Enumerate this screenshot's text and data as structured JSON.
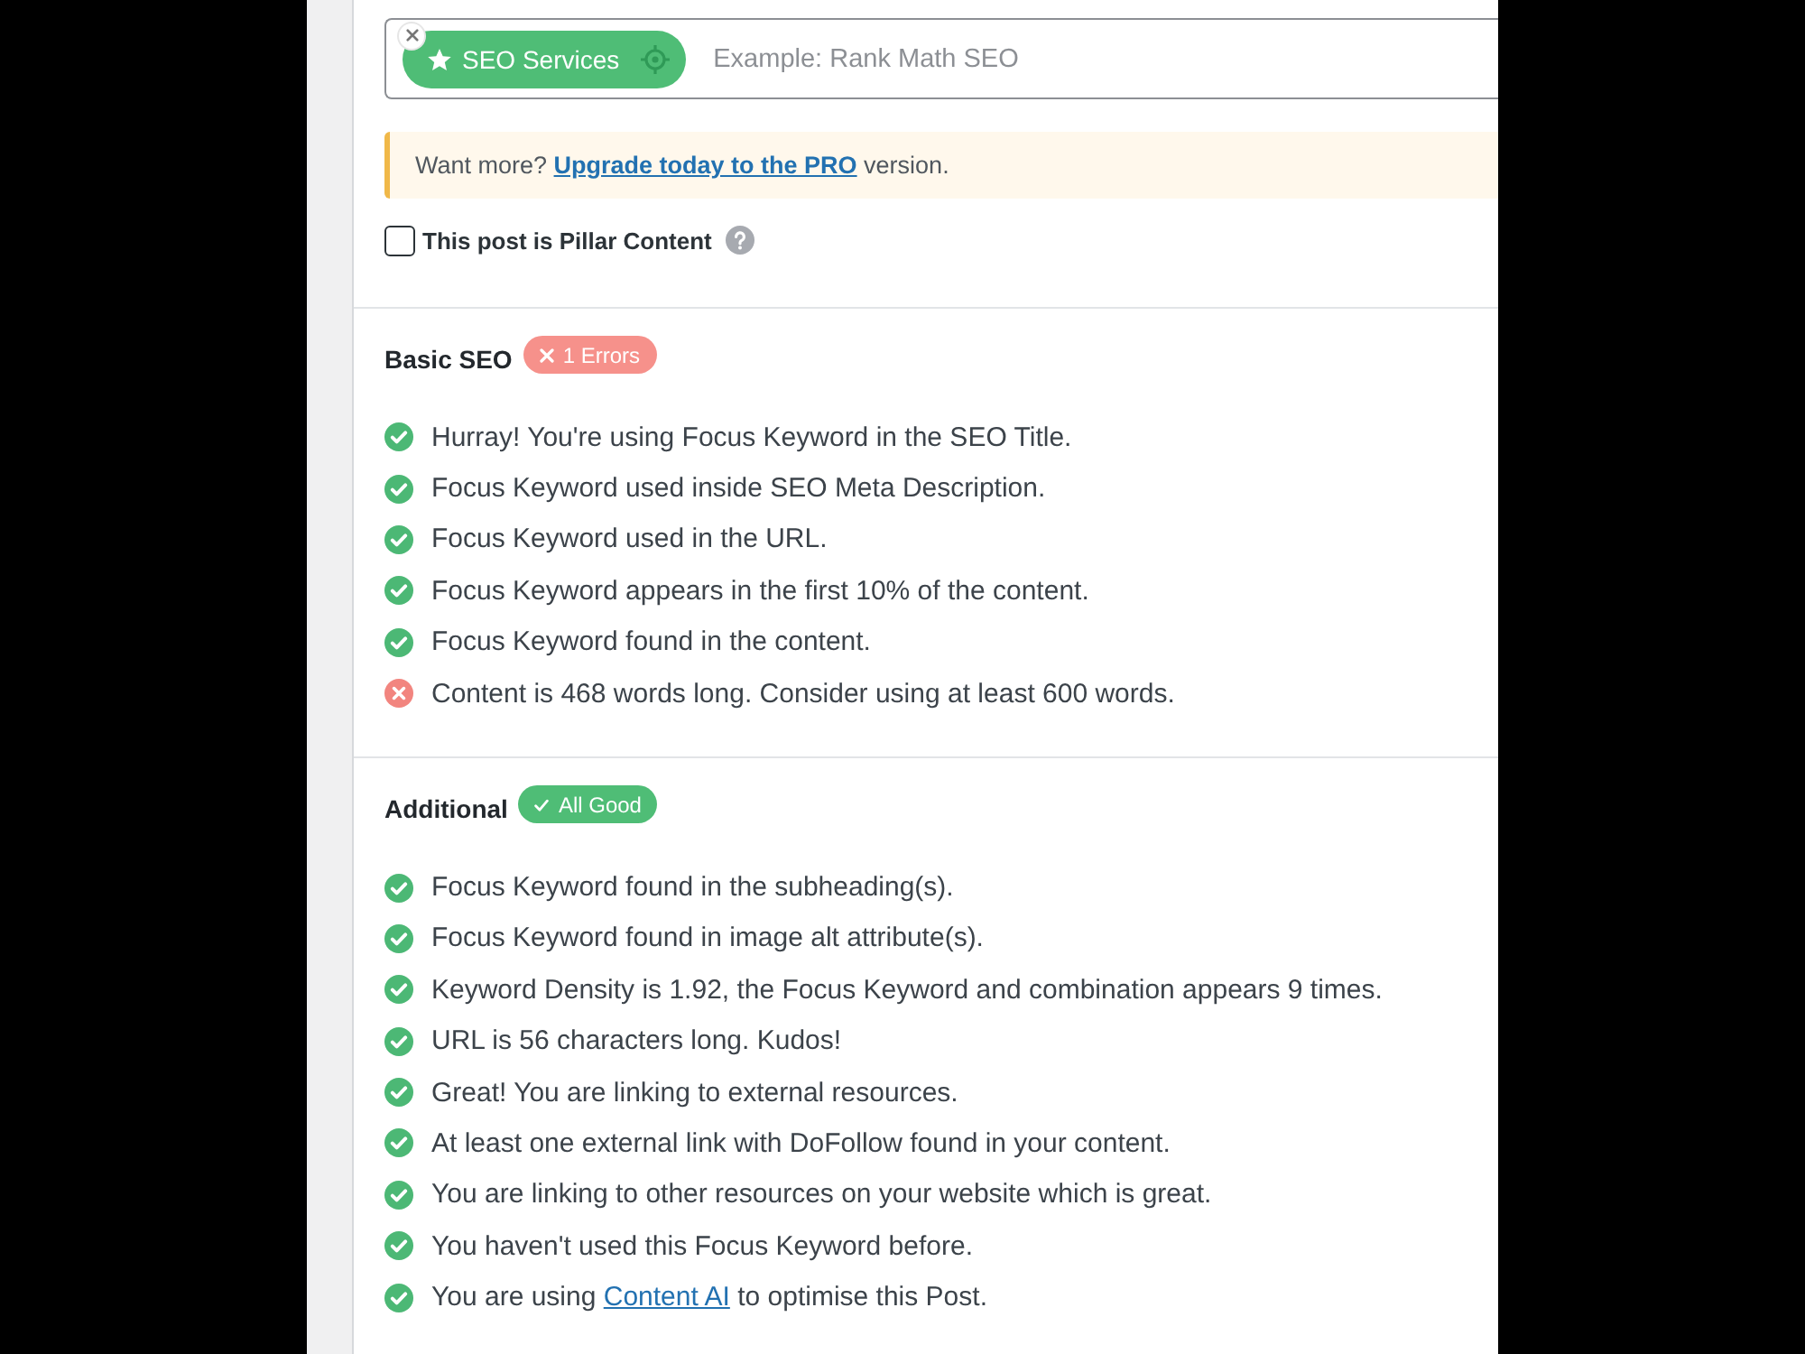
{
  "keyword_field": {
    "tags": [
      {
        "label": "SEO Services",
        "primary": true
      }
    ],
    "placeholder": "Example: Rank Math SEO"
  },
  "notice": {
    "text": "Want more? ",
    "link": "Upgrade today to the PRO",
    "after": " version."
  },
  "pillar_content": {
    "label": "This post is Pillar Content",
    "checked": false
  },
  "sections": [
    {
      "title": "Basic SEO",
      "badge": {
        "kind": "error",
        "label": "1 Errors"
      },
      "items": [
        {
          "kind": "pass",
          "text": "Hurray! You're using Focus Keyword in the SEO Title."
        },
        {
          "kind": "pass",
          "text": "Focus Keyword used inside SEO Meta Description."
        },
        {
          "kind": "pass",
          "text": "Focus Keyword used in the URL."
        },
        {
          "kind": "pass",
          "text": "Focus Keyword appears in the first 10% of the content."
        },
        {
          "kind": "pass",
          "text": "Focus Keyword found in the content."
        },
        {
          "kind": "fail",
          "text": "Content is 468 words long. Consider using at least 600 words."
        }
      ]
    },
    {
      "title": "Additional",
      "badge": {
        "kind": "good",
        "label": "All Good"
      },
      "items": [
        {
          "kind": "pass",
          "text": "Focus Keyword found in the subheading(s)."
        },
        {
          "kind": "pass",
          "text": "Focus Keyword found in image alt attribute(s)."
        },
        {
          "kind": "pass",
          "text": "Keyword Density is 1.92, the Focus Keyword and combination appears 9 times."
        },
        {
          "kind": "pass",
          "text": "URL is 56 characters long. Kudos!"
        },
        {
          "kind": "pass",
          "text": "Great! You are linking to external resources."
        },
        {
          "kind": "pass",
          "text": "At least one external link with DoFollow found in your content."
        },
        {
          "kind": "pass",
          "text": "You are linking to other resources on your website which is great."
        },
        {
          "kind": "pass",
          "text": "You haven't used this Focus Keyword before."
        },
        {
          "kind": "pass",
          "text": "You are using ",
          "link": "Content AI",
          "after": " to optimise this Post."
        }
      ]
    }
  ]
}
